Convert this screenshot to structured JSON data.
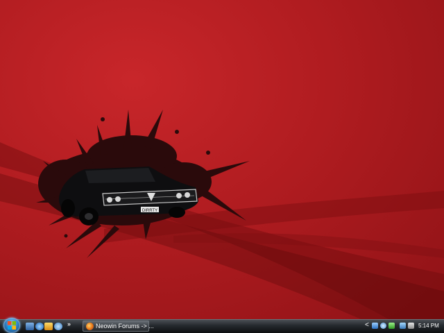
{
  "desktop": {
    "wallpaper": {
      "description_icon": "car-splatter-wallpaper",
      "license_plate": "DIRRTY",
      "colors": {
        "background": "#b01c20",
        "splatter": "#2a0a0b",
        "car": "#0e0e10"
      }
    }
  },
  "taskbar": {
    "start_icon": "windows-logo-icon",
    "quick_launch": [
      {
        "icon": "show-desktop-icon"
      },
      {
        "icon": "internet-explorer-icon"
      },
      {
        "icon": "media-player-icon"
      },
      {
        "icon": "switch-windows-icon"
      }
    ],
    "quick_launch_more": "»",
    "tasks": [
      {
        "label": "Neowin Forums -> ...",
        "icon": "firefox-icon"
      }
    ],
    "tray": {
      "expand": "<",
      "icons": [
        "network-icon",
        "messenger-icon",
        "shield-icon",
        "monitor-icon",
        "volume-icon"
      ],
      "clock": "5:14 PM"
    }
  }
}
